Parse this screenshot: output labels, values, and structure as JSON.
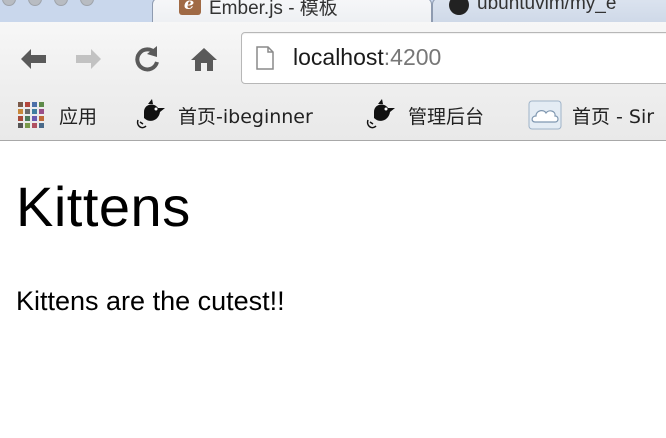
{
  "browser": {
    "tabs": [
      {
        "title": "Ember.js - 模板",
        "icon": "ember-favicon",
        "active": true
      },
      {
        "title": "ubuntuvim/my_e",
        "icon": "github-favicon",
        "active": false
      }
    ],
    "nav": {
      "back_icon": "back-arrow-icon",
      "forward_icon": "forward-arrow-icon",
      "reload_icon": "reload-icon",
      "home_icon": "home-icon"
    },
    "address": {
      "host": "localhost",
      "port": ":4200"
    },
    "bookmarks": [
      {
        "label": "应用",
        "icon": "apps-grid-icon"
      },
      {
        "label": "首页-ibeginner",
        "icon": "bird-icon"
      },
      {
        "label": "管理后台",
        "icon": "bird-icon"
      },
      {
        "label": "首页 - Sir",
        "icon": "cloud-icon"
      }
    ]
  },
  "page": {
    "title": "Kittens",
    "text": "Kittens are the cutest!!"
  },
  "colors": {
    "tabstrip": "#c9d7ec",
    "toolbar": "#eeeeee",
    "url_host": "#1a1a1a",
    "url_port": "#777777"
  }
}
